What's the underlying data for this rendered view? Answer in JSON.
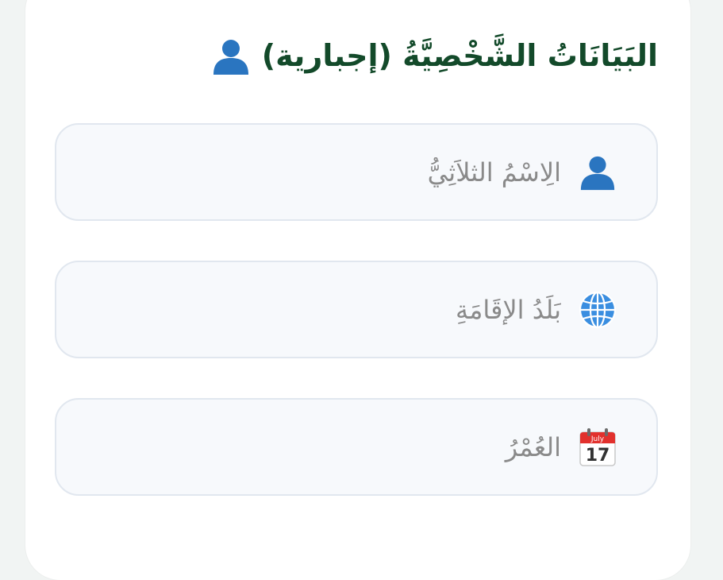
{
  "section": {
    "title": "البَيَانَاتُ الشَّخْصِيَّةُ (إجبارية)",
    "icon": "person-icon",
    "title_color": "#134a2a"
  },
  "fields": [
    {
      "name": "full-name",
      "placeholder": "الِاسْمُ الثلاَثِيُّ",
      "value": "",
      "icon": "person-icon"
    },
    {
      "name": "country",
      "placeholder": "بَلَدُ الإِقَامَةِ",
      "value": "",
      "icon": "globe-icon"
    },
    {
      "name": "age",
      "placeholder": "العُمْرُ",
      "value": "",
      "icon": "calendar-icon"
    }
  ],
  "calendar_icon": {
    "month": "July",
    "day": "17"
  },
  "colors": {
    "field_bg": "#f7f9fc",
    "field_border": "#e1e7ef",
    "icon_blue": "#1f6fbf",
    "calendar_red": "#e2312d"
  }
}
